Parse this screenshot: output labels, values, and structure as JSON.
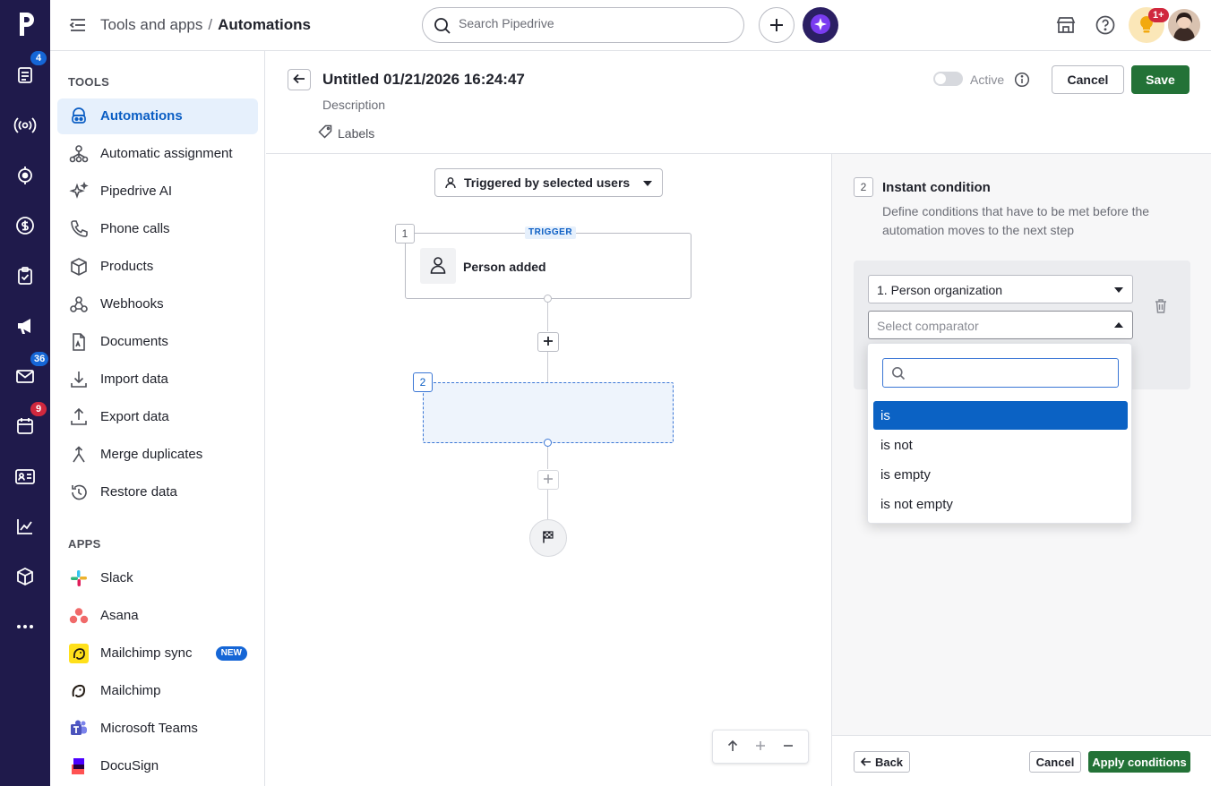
{
  "colors": {
    "rail": "#1f1a4b",
    "accent": "#0b62c4",
    "save_green": "#237237",
    "badge_blue": "#1566d6",
    "badge_red": "#d0283e"
  },
  "rail": {
    "items": [
      {
        "icon": "leads-icon",
        "badge": "4"
      },
      {
        "icon": "broadcast-icon",
        "badge": null
      },
      {
        "icon": "target-icon",
        "badge": null
      },
      {
        "icon": "deals-dollar-icon",
        "badge": null
      },
      {
        "icon": "activities-clipboard-icon",
        "badge": null
      },
      {
        "icon": "campaigns-megaphone-icon",
        "badge": null
      },
      {
        "icon": "mail-icon",
        "badge": "36"
      },
      {
        "icon": "calendar-icon",
        "badge": "9"
      },
      {
        "icon": "contacts-card-icon",
        "badge": null
      },
      {
        "icon": "insights-chart-icon",
        "badge": null
      },
      {
        "icon": "products-box-icon",
        "badge": null
      },
      {
        "icon": "more-dots-icon",
        "badge": null
      }
    ]
  },
  "topbar": {
    "crumb_parent": "Tools and apps",
    "crumb_sep": "/",
    "crumb_current": "Automations",
    "search_placeholder": "Search Pipedrive",
    "notification_badge": "1+"
  },
  "sidebar": {
    "tools_title": "TOOLS",
    "tools": [
      {
        "label": "Automations",
        "icon": "automations-icon",
        "active": true
      },
      {
        "label": "Automatic assignment",
        "icon": "assignment-icon",
        "active": false
      },
      {
        "label": "Pipedrive AI",
        "icon": "sparkle-icon",
        "active": false
      },
      {
        "label": "Phone calls",
        "icon": "phone-icon",
        "active": false
      },
      {
        "label": "Products",
        "icon": "box-icon",
        "active": false
      },
      {
        "label": "Webhooks",
        "icon": "webhook-icon",
        "active": false
      },
      {
        "label": "Documents",
        "icon": "document-icon",
        "active": false
      },
      {
        "label": "Import data",
        "icon": "import-icon",
        "active": false
      },
      {
        "label": "Export data",
        "icon": "export-icon",
        "active": false
      },
      {
        "label": "Merge duplicates",
        "icon": "merge-icon",
        "active": false
      },
      {
        "label": "Restore data",
        "icon": "restore-icon",
        "active": false
      }
    ],
    "apps_title": "APPS",
    "apps": [
      {
        "label": "Slack",
        "icon": "slack-icon",
        "badge": null
      },
      {
        "label": "Asana",
        "icon": "asana-icon",
        "badge": null
      },
      {
        "label": "Mailchimp sync",
        "icon": "mailchimp-sync-icon",
        "badge": "NEW"
      },
      {
        "label": "Mailchimp",
        "icon": "mailchimp-icon",
        "badge": null
      },
      {
        "label": "Microsoft Teams",
        "icon": "teams-icon",
        "badge": null
      },
      {
        "label": "DocuSign",
        "icon": "docusign-icon",
        "badge": null
      }
    ]
  },
  "editor": {
    "title": "Untitled 01/21/2026 16:24:47",
    "description": "Description",
    "labels": "Labels",
    "active_label": "Active",
    "active": false,
    "cancel_label": "Cancel",
    "save_label": "Save"
  },
  "canvas": {
    "trigger_select": "Triggered by selected users",
    "step1_number": "1",
    "trigger_tag": "TRIGGER",
    "step1_label": "Person added",
    "step2_number": "2"
  },
  "panel": {
    "step_number": "2",
    "title": "Instant condition",
    "description": "Define conditions that have to be met before the automation moves to the next step",
    "field_value": "1. Person organization",
    "comparator_placeholder": "Select comparator",
    "back_label": "Back",
    "cancel_label": "Cancel",
    "apply_label": "Apply conditions"
  },
  "comparator_menu": {
    "search_value": "",
    "options": [
      {
        "label": "is",
        "selected": true
      },
      {
        "label": "is not",
        "selected": false
      },
      {
        "label": "is empty",
        "selected": false
      },
      {
        "label": "is not empty",
        "selected": false
      }
    ]
  }
}
